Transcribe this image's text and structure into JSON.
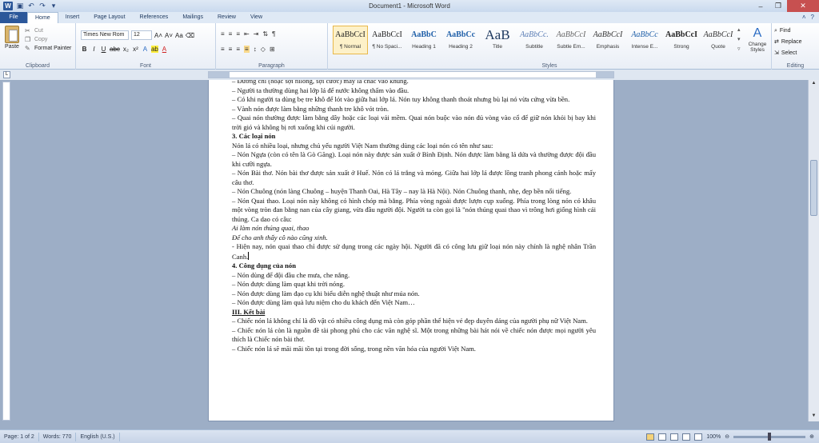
{
  "window": {
    "title": "Document1 - Microsoft Word",
    "controls": [
      "‒",
      "❐",
      "✕"
    ]
  },
  "qat": {
    "logo": "W",
    "undo": "↶",
    "redo": "↷",
    "save": "💾"
  },
  "tabs": [
    "File",
    "Home",
    "Insert",
    "Page Layout",
    "References",
    "Mailings",
    "Review",
    "View"
  ],
  "ribbon": {
    "clipboard": {
      "paste": "Paste",
      "cut": "Cut",
      "copy": "Copy",
      "format_painter": "Format Painter",
      "label": "Clipboard"
    },
    "font": {
      "name": "Times New Rom",
      "size": "12",
      "label": "Font",
      "buttons_row1": [
        "A˄",
        "A˅",
        "Aa",
        "⌫"
      ],
      "buttons_row2": [
        "B",
        "I",
        "U",
        "abc",
        "x₂",
        "x²",
        "A",
        "ab",
        "A"
      ]
    },
    "paragraph": {
      "label": "Paragraph",
      "row1": [
        "≡",
        "≡",
        "≡",
        "⇤",
        "⇥",
        "⇅",
        "¶"
      ],
      "row2": [
        "≡",
        "≡",
        "≡",
        "≡",
        "↕",
        "◇",
        "⊞"
      ]
    },
    "styles": {
      "label": "Styles",
      "items": [
        {
          "sample": "AaBbCcI",
          "name": "¶ Normal"
        },
        {
          "sample": "AaBbCcI",
          "name": "¶ No Spaci..."
        },
        {
          "sample": "AaBbC",
          "name": "Heading 1"
        },
        {
          "sample": "AaBbCc",
          "name": "Heading 2"
        },
        {
          "sample": "AaB",
          "name": "Title"
        },
        {
          "sample": "AaBbCc.",
          "name": "Subtitle"
        },
        {
          "sample": "AaBbCcI",
          "name": "Subtle Em..."
        },
        {
          "sample": "AaBbCcI",
          "name": "Emphasis"
        },
        {
          "sample": "AaBbCc",
          "name": "Intense E..."
        },
        {
          "sample": "AaBbCcI",
          "name": "Strong"
        },
        {
          "sample": "AaBbCcI",
          "name": "Quote"
        }
      ],
      "change_styles": "Change Styles"
    },
    "editing": {
      "label": "Editing",
      "find": "Find",
      "replace": "Replace",
      "select": "Select"
    }
  },
  "document": {
    "paragraphs": [
      {
        "text": "– Đường chỉ (hoặc sợi nilông, sợi cước) may lá chắc vào khung.",
        "style": "p"
      },
      {
        "text": "– Người ta thường dùng hai lớp lá để nước không thấm vào đầu.",
        "style": "p"
      },
      {
        "text": "– Có khi người ta dùng bẹ tre khô để lót vào giữa hai lớp lá. Nón tuy không thanh thoát nhưng bù lại nó vừa cứng vừa bền.",
        "style": "p"
      },
      {
        "text": "– Vành nón được làm bằng những thanh tre khô vót tròn.",
        "style": "p"
      },
      {
        "text": "– Quai nón thường được làm bằng dây hoặc các loại vải mềm. Quai nón buộc vào nón đủ vòng vào cổ để giữ nón khỏi bị bay khi trời gió và không bị rơi xuống khi cúi người.",
        "style": "p"
      },
      {
        "text": "3. Các loại nón",
        "style": "h"
      },
      {
        "text": "Nón lá có nhiều loại, nhưng chủ yếu người Việt Nam thường dùng các loại nón có tên như sau:",
        "style": "p"
      },
      {
        "text": "– Nón Ngựa (còn có tên là Gò Găng). Loại nón này được sản xuất ở Bình Định. Nón được làm bằng lá dứa và thường được đội đầu khi cưỡi ngựa.",
        "style": "p"
      },
      {
        "text": "– Nón Bài thơ. Nón bài thơ được sản xuất ở Huế. Nón có lá trắng và mỏng. Giữa hai lớp lá được lồng tranh phong cảnh hoặc mấy câu thơ.",
        "style": "p"
      },
      {
        "text": "– Nón Chuông (nón làng Chuông – huyện Thanh Oai, Hà Tây – nay là Hà Nội). Nón Chuông thanh, nhẹ, đẹp bền nổi tiếng.",
        "style": "p"
      },
      {
        "text": "– Nón Quai thao. Loại nón này không có hình chóp mà bằng. Phía vòng ngoài được lượn cụp xuống. Phía trong lòng nón có khâu một vòng tròn đan bằng nan của cây giang, vừa đầu người đội. Người ta còn gọi là \"nón thúng quai thao vì trông hơi giống hình cái thúng. Ca dao có câu:",
        "style": "p"
      },
      {
        "text": "Ai làm nón thúng quai, thao",
        "style": "it"
      },
      {
        "text": "Để cho anh thấy cô nào cũng xinh.",
        "style": "it"
      },
      {
        "text": "- Hiện nay, nón quai thao chỉ được sử dụng trong các ngày hội. Người đã có công lưu giữ loại nón này chính là nghệ nhân Trần Canh.",
        "style": "p",
        "caret": true
      },
      {
        "text": "4. Công dụng của nón",
        "style": "h"
      },
      {
        "text": "– Nón dùng để đội đầu che mưa, che nắng.",
        "style": "p"
      },
      {
        "text": "– Nón được dùng làm quạt khi trời nóng.",
        "style": "p"
      },
      {
        "text": "– Nón được dùng làm đạo cụ khi biểu diễn nghệ thuật như múa nón.",
        "style": "p"
      },
      {
        "text": "– Nón được dùng làm quà lưu niệm cho du khách đến Việt Nam…",
        "style": "p"
      },
      {
        "text": "III. Kết bài",
        "style": "u"
      },
      {
        "text": "– Chiếc nón lá không chỉ là đồ vật có nhiều công dụng mà còn góp phần thể hiện vẻ đẹp duyên dáng của người phụ nữ Việt Nam.",
        "style": "p"
      },
      {
        "text": "– Chiếc nón lá còn là nguồn đề tài phong phú cho các văn nghệ sĩ. Một trong những bài hát nói về chiếc nón được mọi người yêu thích là Chiếc nón bài thơ.",
        "style": "p"
      },
      {
        "text": "– Chiếc nón lá sẽ mãi mãi tồn tại trong đời sống, trong nền văn hóa của người Việt Nam.",
        "style": "p"
      }
    ]
  },
  "status": {
    "page": "Page: 1 of 2",
    "words": "Words: 770",
    "language": "English (U.S.)",
    "zoom": "100%"
  }
}
